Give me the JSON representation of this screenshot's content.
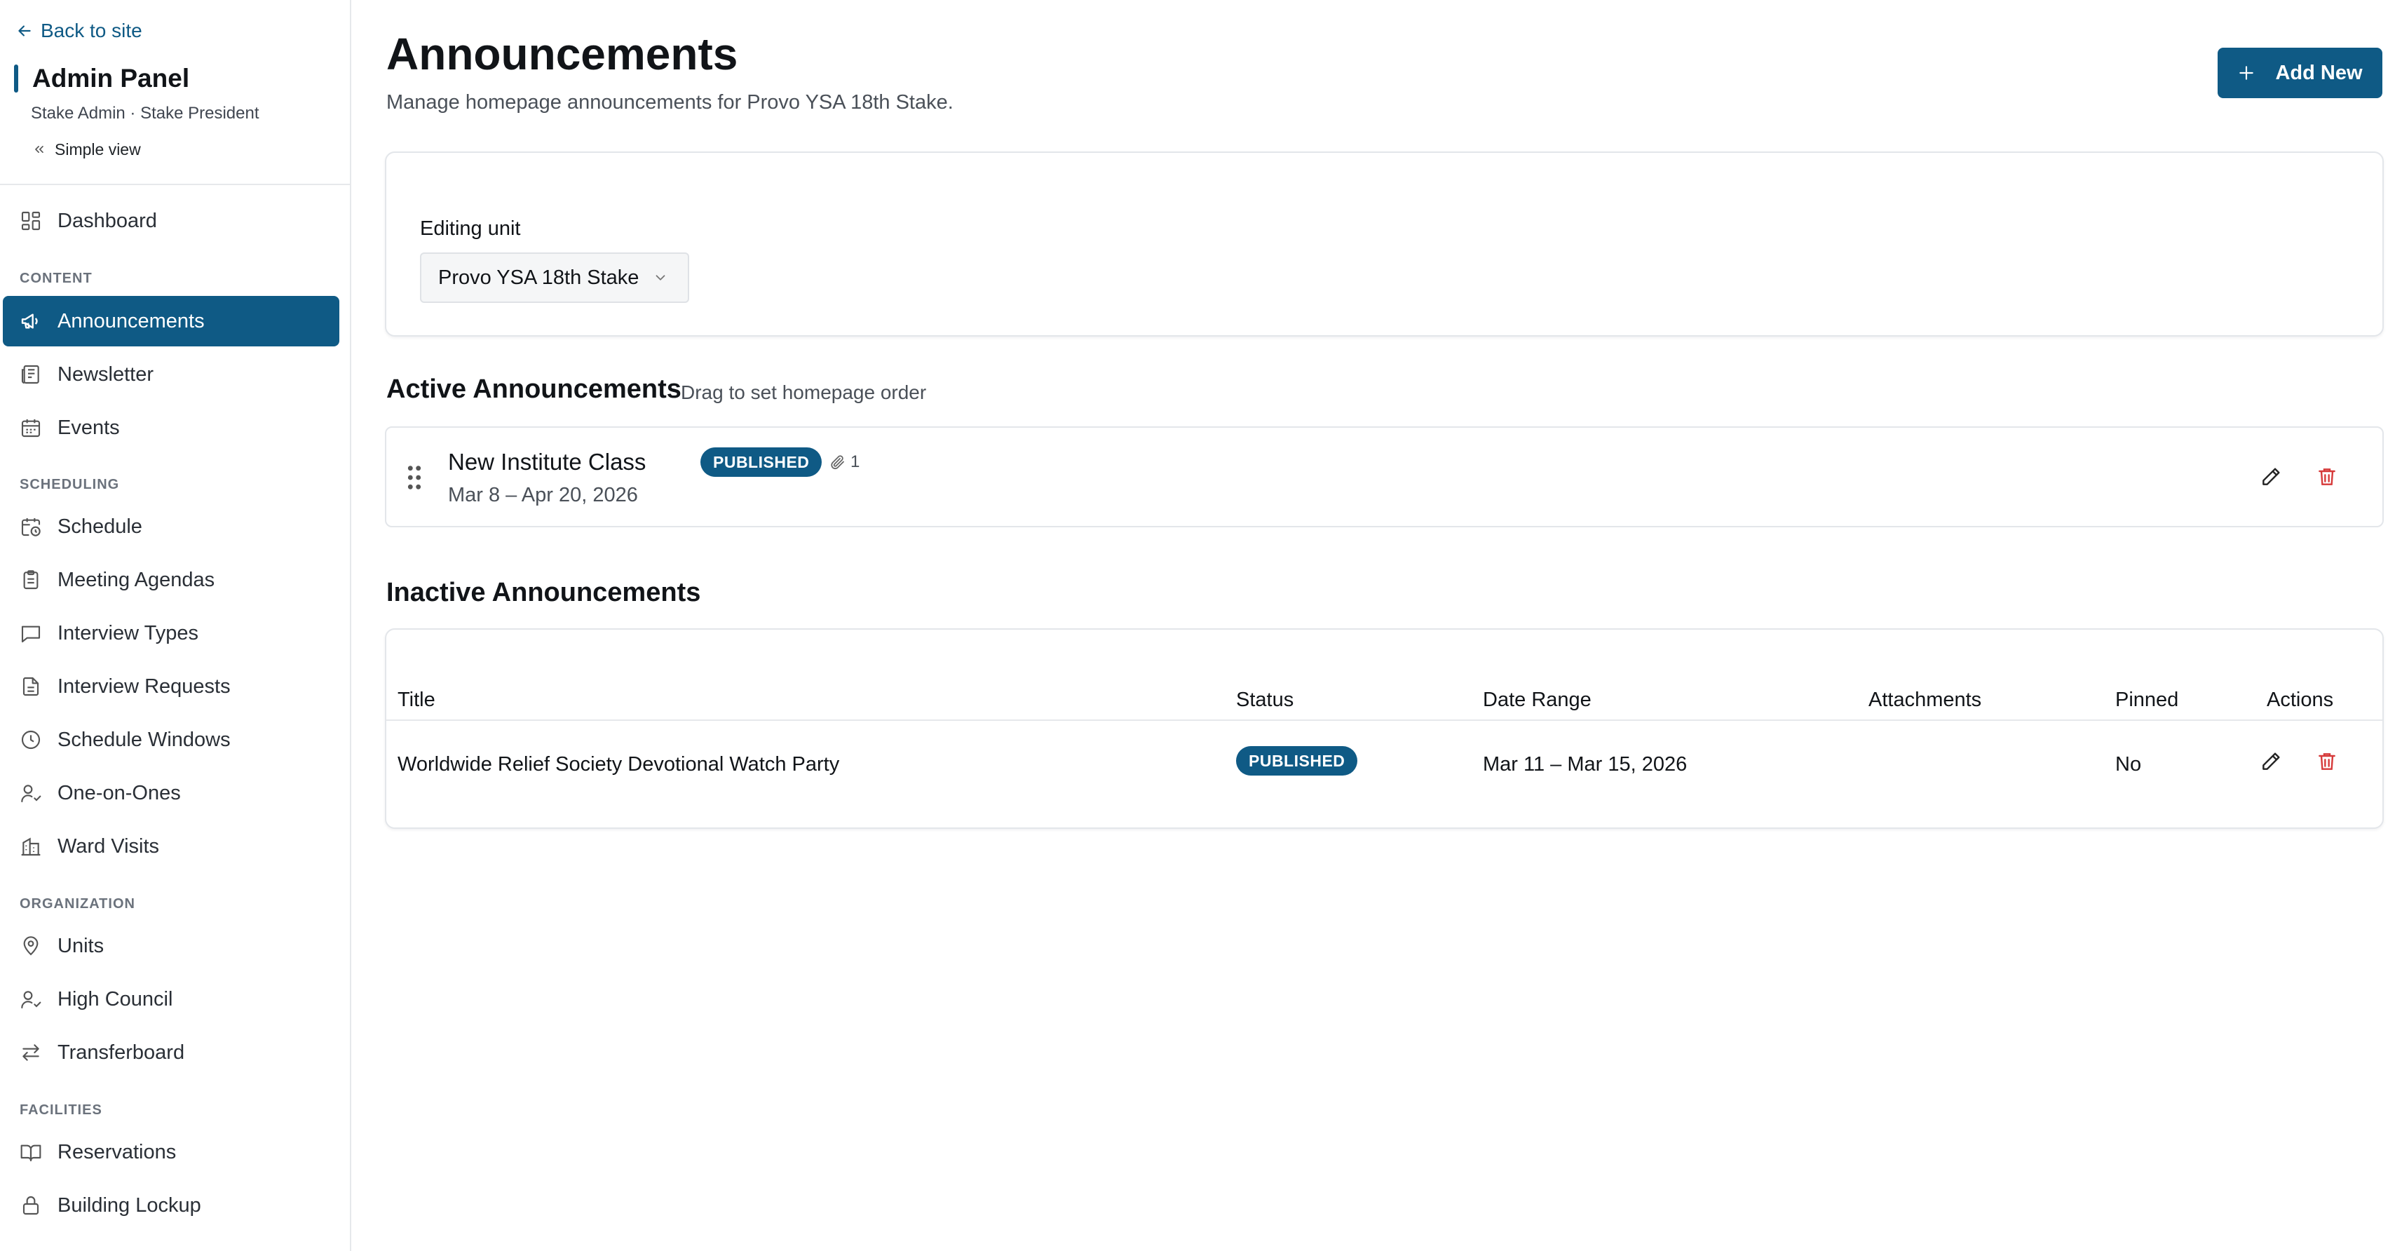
{
  "sidebar": {
    "back_label": "Back to site",
    "panel_title": "Admin Panel",
    "panel_subtitle": "Stake Admin · Stake President",
    "simple_view_label": "Simple view",
    "dashboard_label": "Dashboard",
    "sections": {
      "content": "CONTENT",
      "scheduling": "SCHEDULING",
      "organization": "ORGANIZATION",
      "facilities": "FACILITIES"
    },
    "items": {
      "announcements": "Announcements",
      "newsletter": "Newsletter",
      "events": "Events",
      "schedule": "Schedule",
      "meeting_agendas": "Meeting Agendas",
      "interview_types": "Interview Types",
      "interview_requests": "Interview Requests",
      "schedule_windows": "Schedule Windows",
      "one_on_ones": "One-on-Ones",
      "ward_visits": "Ward Visits",
      "units": "Units",
      "high_council": "High Council",
      "transferboard": "Transferboard",
      "reservations": "Reservations",
      "building_lockup": "Building Lockup"
    },
    "active_item": "Announcements"
  },
  "header": {
    "title": "Announcements",
    "description": "Manage homepage announcements for Provo YSA 18th Stake.",
    "add_button_label": "Add New"
  },
  "unit_picker": {
    "label": "Editing unit",
    "selected": "Provo YSA 18th Stake"
  },
  "active_section": {
    "title": "Active Announcements",
    "hint": "Drag to set homepage order",
    "items": [
      {
        "title": "New Institute Class",
        "status": "PUBLISHED",
        "attachments": "1",
        "dates": "Mar 8 – Apr 20, 2026"
      }
    ]
  },
  "inactive_section": {
    "title": "Inactive Announcements",
    "columns": [
      "Title",
      "Status",
      "Date Range",
      "Attachments",
      "Pinned",
      "Actions"
    ],
    "rows": [
      {
        "title": "Worldwide Relief Society Devotional Watch Party",
        "status": "PUBLISHED",
        "date_range": "Mar 11 – Mar 15, 2026",
        "attachments": "",
        "pinned": "No"
      }
    ]
  },
  "colors": {
    "accent": "#0f5a85",
    "danger": "#d63a3a",
    "border": "#e3e6ea"
  },
  "icons": {
    "back": "arrow-left-icon",
    "simple_view": "chevrons-left-icon",
    "add": "plus-icon",
    "select": "chevron-down-icon",
    "drag": "drag-handle-icon",
    "attachment": "paperclip-icon",
    "edit": "pencil-icon",
    "delete": "trash-icon"
  }
}
